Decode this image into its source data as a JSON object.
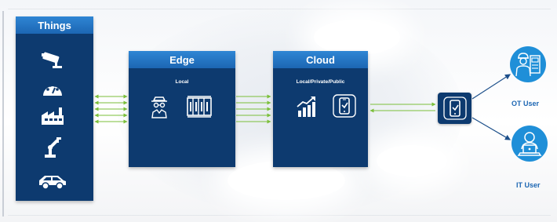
{
  "diagram": {
    "things": {
      "title": "Things"
    },
    "edge": {
      "title": "Edge",
      "subtitle": "Local"
    },
    "cloud": {
      "title": "Cloud",
      "subtitle": "Local/Private/Public"
    },
    "users": [
      {
        "label": "OT User"
      },
      {
        "label": "IT User"
      }
    ]
  },
  "icons": {
    "things": [
      "security-camera-icon",
      "gauge-icon",
      "factory-icon",
      "robot-arm-icon",
      "car-icon"
    ],
    "edge": [
      "spy-agent-icon",
      "server-rack-icon"
    ],
    "cloud": [
      "growth-chart-icon",
      "mobile-app-icon"
    ],
    "device": "smartphone-icon",
    "ot_user": "operator-icon",
    "it_user": "laptop-user-icon"
  },
  "colors": {
    "panel": "#0d3a6f",
    "panel_header": "#1c66b3",
    "arrows": "#7bbf3a",
    "user_circle": "#1f8fd8",
    "user_label": "#1c66b3"
  }
}
